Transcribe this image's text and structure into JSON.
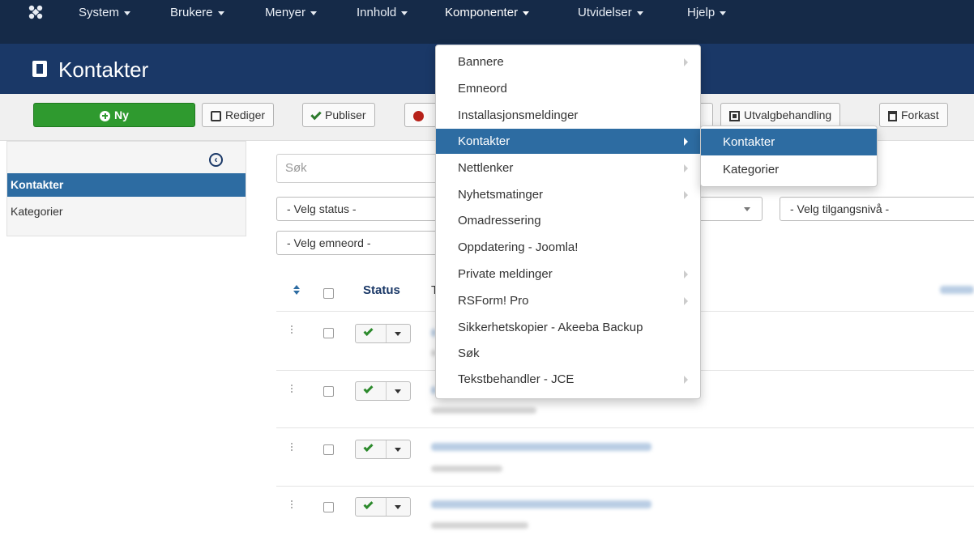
{
  "navbar": {
    "logo_icon": "joomla-logo-icon",
    "items": [
      {
        "label": "System"
      },
      {
        "label": "Brukere"
      },
      {
        "label": "Menyer"
      },
      {
        "label": "Innhold"
      },
      {
        "label": "Komponenter"
      },
      {
        "label": "Utvidelser"
      },
      {
        "label": "Hjelp"
      }
    ]
  },
  "header": {
    "title": "Kontakter",
    "icon": "address-book-icon"
  },
  "toolbar": {
    "new": "Ny",
    "edit": "Rediger",
    "publish": "Publiser",
    "batch": "Utvalgbehandling",
    "trash": "Forkast"
  },
  "sidebar": {
    "items": [
      {
        "label": "Kontakter"
      },
      {
        "label": "Kategorier"
      }
    ]
  },
  "filters": {
    "search_placeholder": "Søk",
    "status": "- Velg status -",
    "access": "- Velg tilgangsnivå -",
    "tag": "- Velg emneord -"
  },
  "table": {
    "status_header": "Status",
    "title_header_fragment": "T"
  },
  "components_menu": {
    "items": [
      {
        "label": "Bannere"
      },
      {
        "label": "Emneord"
      },
      {
        "label": "Installasjonsmeldinger"
      },
      {
        "label": "Kontakter"
      },
      {
        "label": "Nettlenker"
      },
      {
        "label": "Nyhetsmatinger"
      },
      {
        "label": "Omadressering"
      },
      {
        "label": "Oppdatering - Joomla!"
      },
      {
        "label": "Private meldinger"
      },
      {
        "label": "RSForm! Pro"
      },
      {
        "label": "Sikkerhetskopier - Akeeba Backup"
      },
      {
        "label": "Søk"
      },
      {
        "label": "Tekstbehandler - JCE"
      }
    ]
  },
  "submenu": {
    "items": [
      {
        "label": "Kontakter"
      },
      {
        "label": "Kategorier"
      }
    ]
  },
  "colors": {
    "navbar_bg": "#152a48",
    "header_bg": "#1a3867",
    "accent": "#2d6ca2",
    "new_button": "#2f9a2f"
  }
}
